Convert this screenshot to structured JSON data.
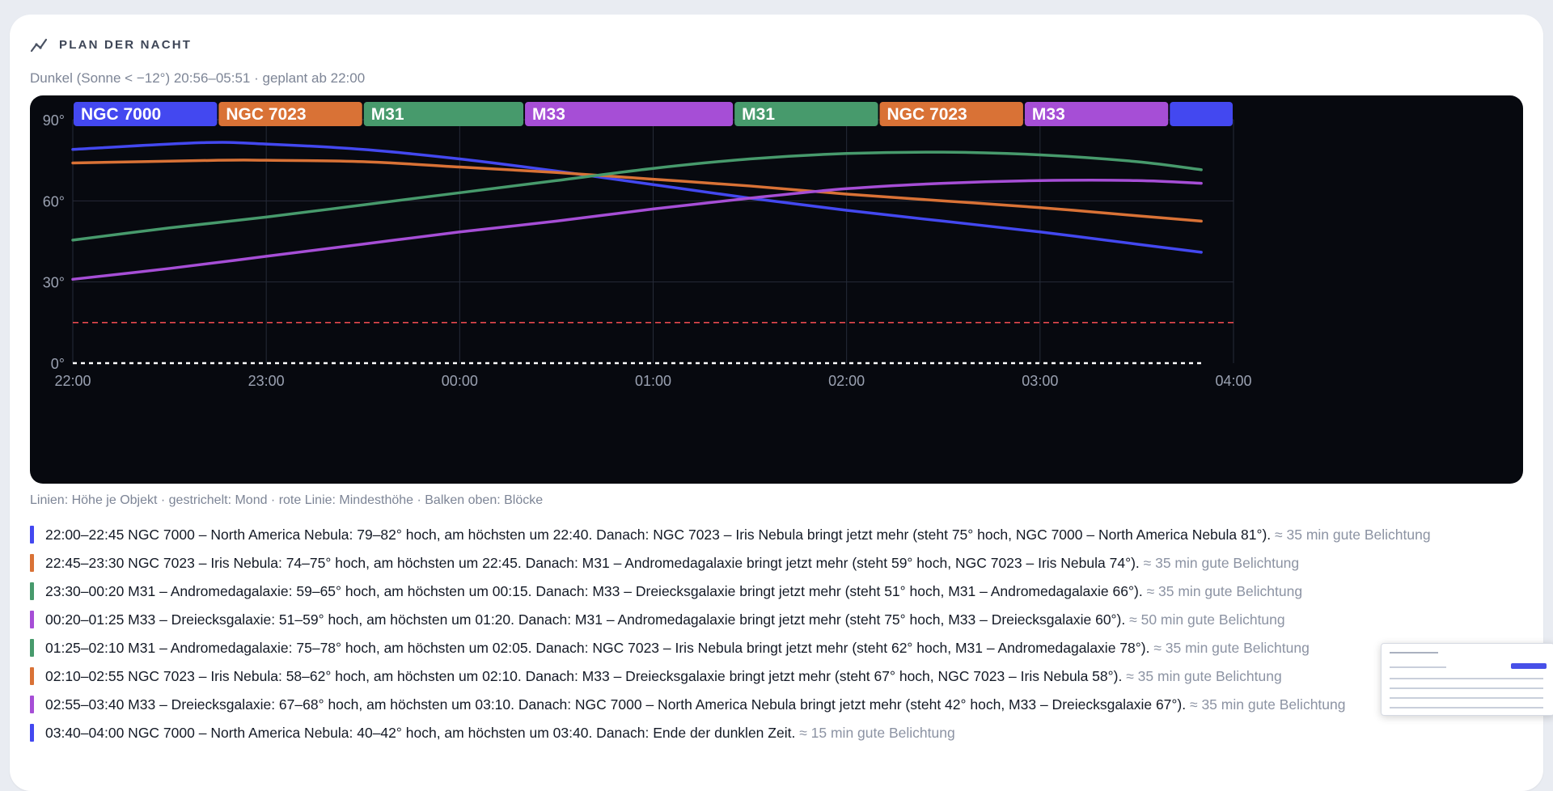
{
  "panel": {
    "title": "PLAN DER NACHT",
    "icon": "line-chart-icon",
    "subtitle": "Dunkel (Sonne < −12°) 20:56–05:51 · geplant ab 22:00",
    "legend": "Linien: Höhe je Objekt · gestrichelt: Mond · rote Linie: Mindesthöhe · Balken oben: Blöcke"
  },
  "colors": {
    "NGC 7000": "#4348f0",
    "NGC 7023": "#d97236",
    "M31": "#479a6c",
    "M33": "#a64ed6",
    "min_line": "#e5484d",
    "moon": "#ffffff",
    "chart_bg": "#07090f",
    "grid": "#262b38",
    "tick_text": "#9aa1b1"
  },
  "chart_data": {
    "type": "line",
    "x_unit": "time",
    "x_ticks": [
      "22:00",
      "23:00",
      "00:00",
      "01:00",
      "02:00",
      "03:00",
      "04:00"
    ],
    "xlim": [
      "22:00",
      "04:00"
    ],
    "y_ticks": [
      "0°",
      "30°",
      "60°",
      "90°"
    ],
    "ylim": [
      0,
      90
    ],
    "grid": true,
    "min_altitude": 15,
    "moon": {
      "x": [
        "22:00",
        "03:50"
      ],
      "y": [
        0,
        0
      ]
    },
    "series": [
      {
        "name": "NGC 7000",
        "x": [
          "22:00",
          "22:40",
          "23:00",
          "23:30",
          "00:00",
          "00:30",
          "01:00",
          "01:30",
          "02:00",
          "02:30",
          "03:00",
          "03:30",
          "03:50"
        ],
        "y": [
          79,
          81.5,
          81,
          79,
          75.5,
          71,
          66,
          61,
          56.5,
          52.5,
          48.5,
          44,
          41
        ]
      },
      {
        "name": "NGC 7023",
        "x": [
          "22:00",
          "22:45",
          "23:00",
          "23:30",
          "00:00",
          "00:30",
          "01:00",
          "01:30",
          "02:00",
          "02:30",
          "03:00",
          "03:30",
          "03:50"
        ],
        "y": [
          74,
          75,
          75,
          74.5,
          72.5,
          70.5,
          68,
          65.5,
          62.5,
          60,
          57.5,
          54.5,
          52.5
        ]
      },
      {
        "name": "M31",
        "x": [
          "22:00",
          "22:30",
          "23:00",
          "23:30",
          "00:00",
          "00:30",
          "01:00",
          "01:30",
          "02:00",
          "02:30",
          "03:00",
          "03:30",
          "03:50"
        ],
        "y": [
          45.5,
          50,
          54,
          58.5,
          63,
          67.5,
          72,
          75.5,
          77.5,
          78,
          77,
          74.5,
          71.5
        ]
      },
      {
        "name": "M33",
        "x": [
          "22:00",
          "22:30",
          "23:00",
          "23:30",
          "00:00",
          "00:30",
          "01:00",
          "01:30",
          "02:00",
          "02:30",
          "03:00",
          "03:30",
          "03:50"
        ],
        "y": [
          31,
          35,
          39.5,
          44,
          48.5,
          52.5,
          57,
          61,
          64.5,
          66.5,
          67.5,
          67.5,
          66.5
        ]
      }
    ],
    "blocks": [
      {
        "label": "NGC 7000",
        "start": "22:00",
        "end": "22:45"
      },
      {
        "label": "NGC 7023",
        "start": "22:45",
        "end": "23:30"
      },
      {
        "label": "M31",
        "start": "23:30",
        "end": "00:20"
      },
      {
        "label": "M33",
        "start": "00:20",
        "end": "01:25"
      },
      {
        "label": "M31",
        "start": "01:25",
        "end": "02:10"
      },
      {
        "label": "NGC 7023",
        "start": "02:10",
        "end": "02:55"
      },
      {
        "label": "M33",
        "start": "02:55",
        "end": "03:40"
      },
      {
        "label": "",
        "color_of": "NGC 7000",
        "start": "03:40",
        "end": "04:00"
      }
    ]
  },
  "schedule": [
    {
      "object": "NGC 7000",
      "text": "22:00–22:45 NGC 7000 – North America Nebula: 79–82° hoch, am höchsten um 22:40. Danach: NGC 7023 – Iris Nebula bringt jetzt mehr (steht 75° hoch, NGC 7000 – North America Nebula 81°).",
      "hint": "≈ 35 min gute Belichtung"
    },
    {
      "object": "NGC 7023",
      "text": "22:45–23:30 NGC 7023 – Iris Nebula: 74–75° hoch, am höchsten um 22:45. Danach: M31 – Andromedagalaxie bringt jetzt mehr (steht 59° hoch, NGC 7023 – Iris Nebula 74°).",
      "hint": "≈ 35 min gute Belichtung"
    },
    {
      "object": "M31",
      "text": "23:30–00:20 M31 – Andromedagalaxie: 59–65° hoch, am höchsten um 00:15. Danach: M33 – Dreiecksgalaxie bringt jetzt mehr (steht 51° hoch, M31 – Andromedagalaxie 66°).",
      "hint": "≈ 35 min gute Belichtung"
    },
    {
      "object": "M33",
      "text": "00:20–01:25 M33 – Dreiecksgalaxie: 51–59° hoch, am höchsten um 01:20. Danach: M31 – Andromedagalaxie bringt jetzt mehr (steht 75° hoch, M33 – Dreiecksgalaxie 60°).",
      "hint": "≈ 50 min gute Belichtung"
    },
    {
      "object": "M31",
      "text": "01:25–02:10 M31 – Andromedagalaxie: 75–78° hoch, am höchsten um 02:05. Danach: NGC 7023 – Iris Nebula bringt jetzt mehr (steht 62° hoch, M31 – Andromedagalaxie 78°).",
      "hint": "≈ 35 min gute Belichtung"
    },
    {
      "object": "NGC 7023",
      "text": "02:10–02:55 NGC 7023 – Iris Nebula: 58–62° hoch, am höchsten um 02:10. Danach: M33 – Dreiecksgalaxie bringt jetzt mehr (steht 67° hoch, NGC 7023 – Iris Nebula 58°).",
      "hint": "≈ 35 min gute Belichtung"
    },
    {
      "object": "M33",
      "text": "02:55–03:40 M33 – Dreiecksgalaxie: 67–68° hoch, am höchsten um 03:10. Danach: NGC 7000 – North America Nebula bringt jetzt mehr (steht 42° hoch, M33 – Dreiecksgalaxie 67°).",
      "hint": "≈ 35 min gute Belichtung"
    },
    {
      "object": "NGC 7000",
      "text": "03:40–04:00 NGC 7000 – North America Nebula: 40–42° hoch, am höchsten um 03:40. Danach: Ende der dunklen Zeit.",
      "hint": "≈ 15 min gute Belichtung"
    }
  ]
}
